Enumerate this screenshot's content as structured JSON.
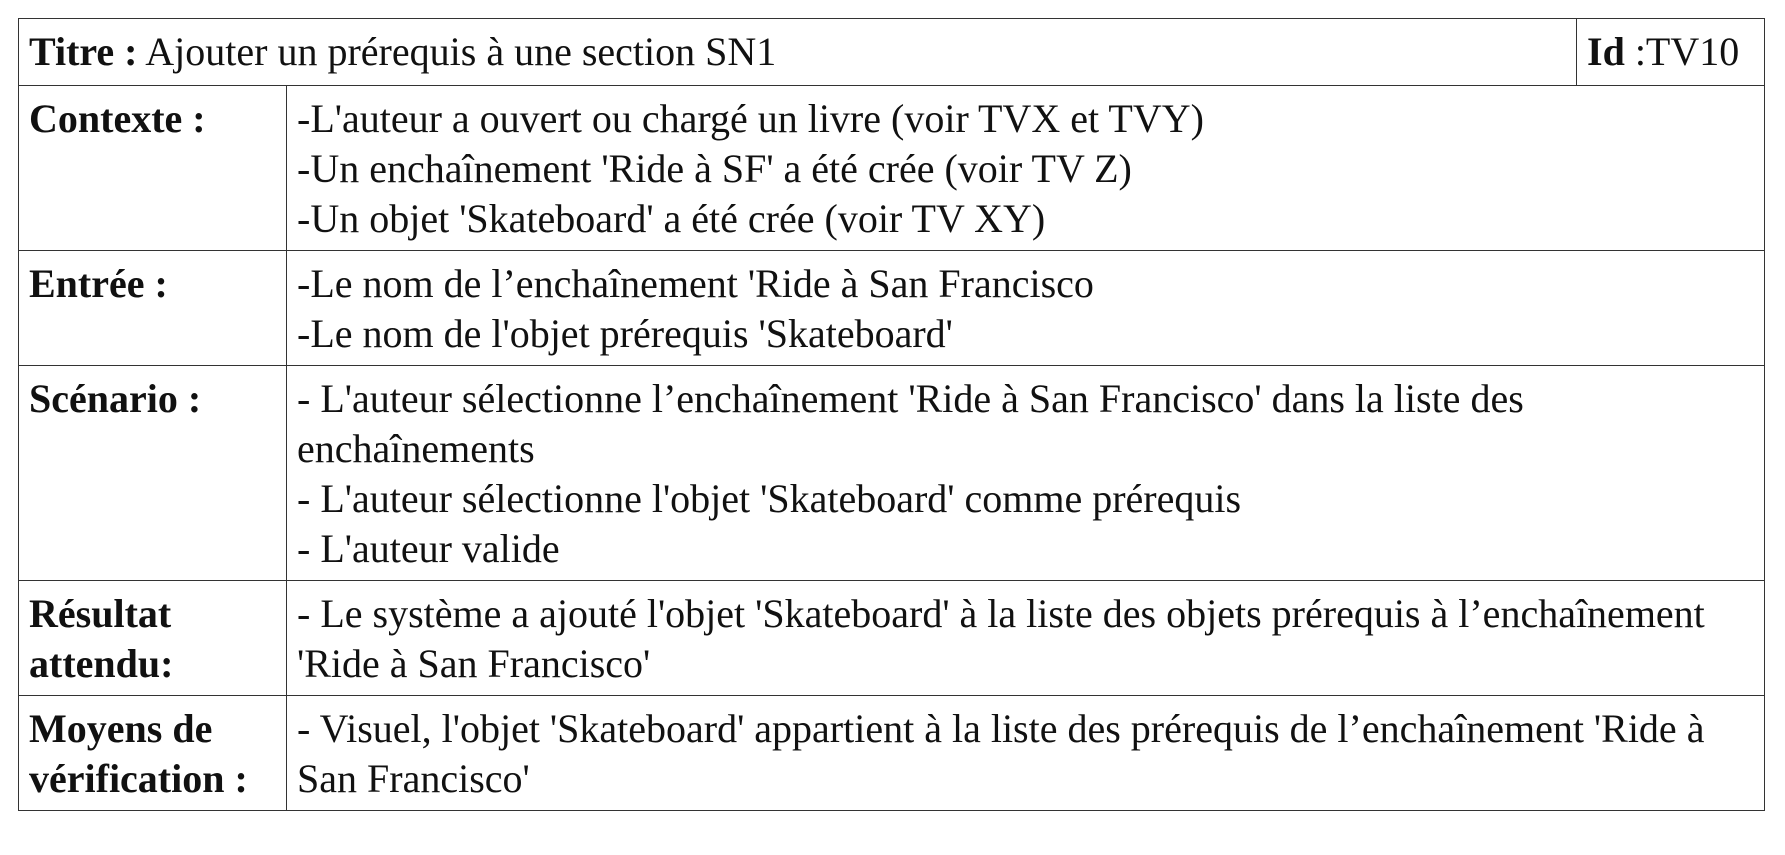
{
  "header": {
    "title_label": "Titre :",
    "title_value": "Ajouter un prérequis à une section SN1",
    "id_label": "Id",
    "id_value": ":TV10"
  },
  "rows": [
    {
      "label": "Contexte :",
      "lines": [
        "-L'auteur a ouvert ou chargé un livre (voir TVX et TVY)",
        "-Un enchaînement 'Ride à SF' a été crée (voir TV Z)",
        "-Un objet 'Skateboard' a été crée (voir TV XY)"
      ]
    },
    {
      "label": "Entrée :",
      "lines": [
        "-Le nom de l’enchaînement 'Ride à San Francisco",
        "-Le nom de l'objet prérequis 'Skateboard'"
      ]
    },
    {
      "label": "Scénario :",
      "lines": [
        "- L'auteur sélectionne l’enchaînement 'Ride à San Francisco' dans la liste des enchaînements",
        "- L'auteur sélectionne l'objet 'Skateboard' comme prérequis",
        "- L'auteur valide"
      ]
    },
    {
      "label": "Résultat attendu:",
      "lines": [
        "- Le système a ajouté l'objet 'Skateboard' à la liste des objets prérequis à l’enchaînement 'Ride à San Francisco'"
      ]
    },
    {
      "label": "Moyens de vérification :",
      "lines": [
        "- Visuel, l'objet 'Skateboard' appartient à la liste des prérequis de l’enchaînement 'Ride à San Francisco'"
      ]
    }
  ]
}
